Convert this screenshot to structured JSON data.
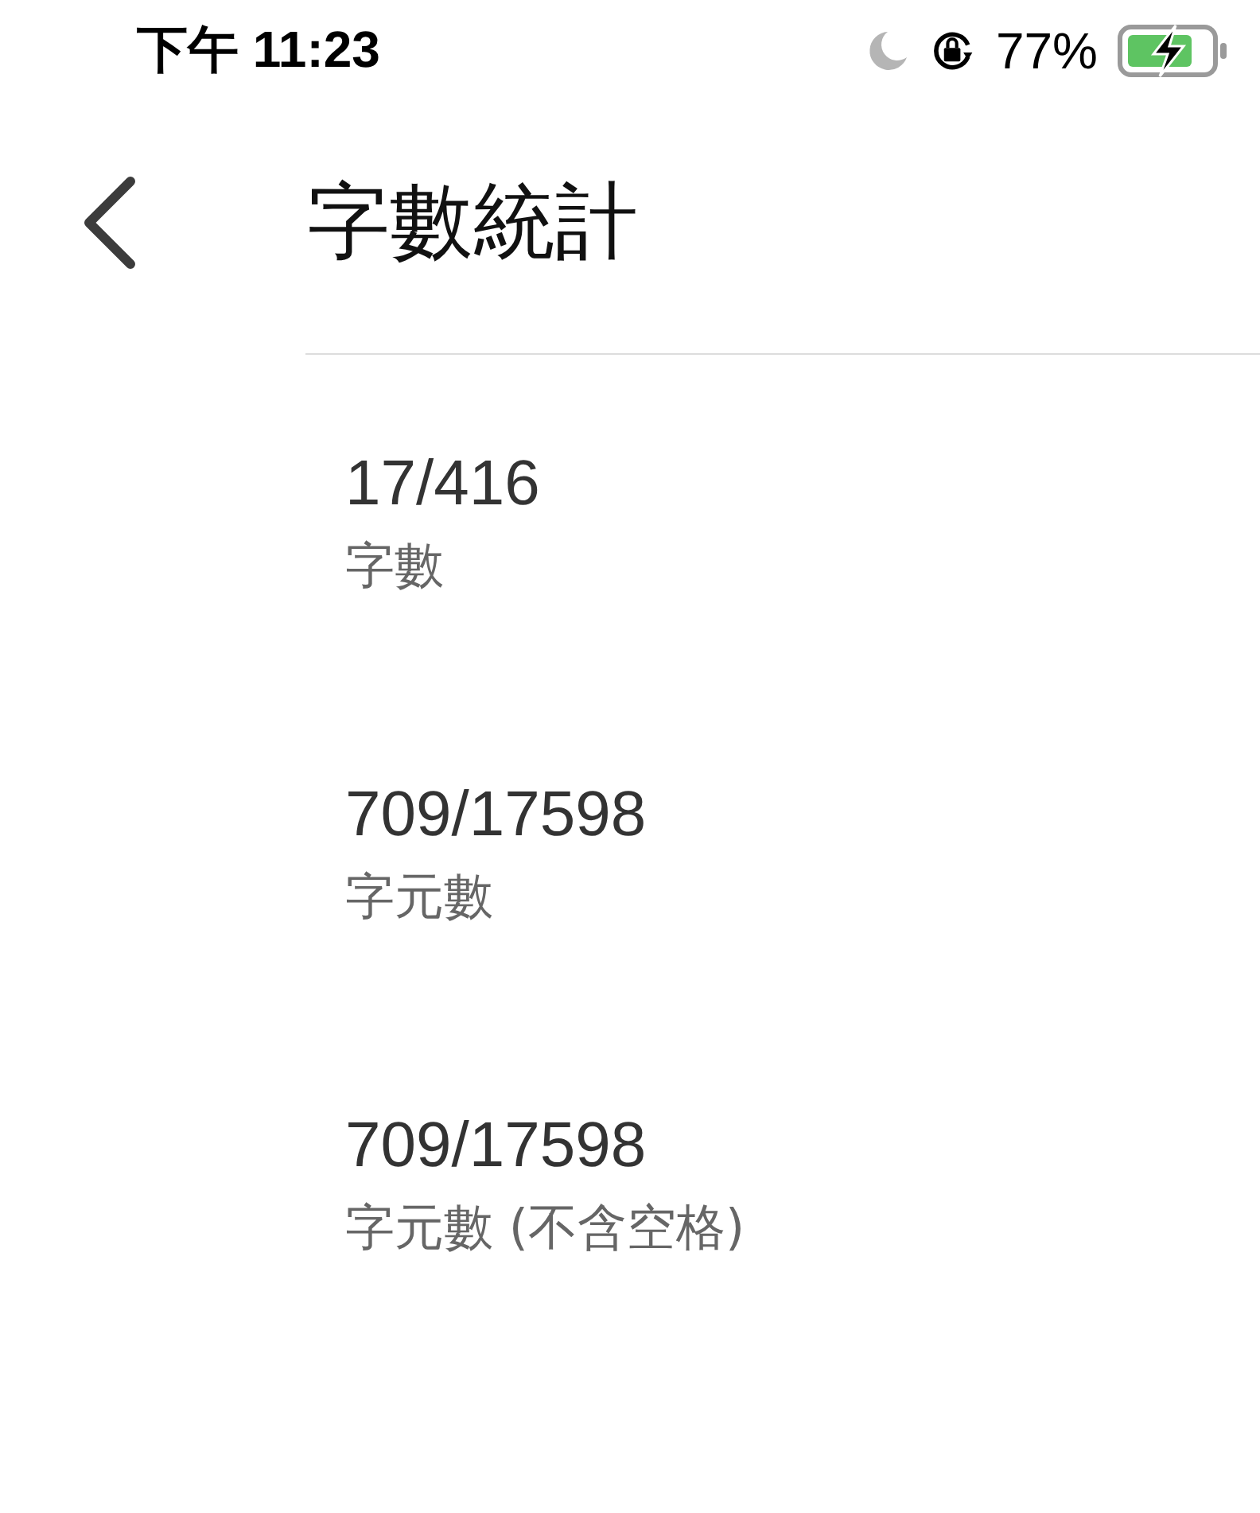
{
  "status_bar": {
    "time": "下午 11:23",
    "battery": "77%"
  },
  "header": {
    "title": "字數統計"
  },
  "stats": [
    {
      "value": "17/416",
      "label": "字數"
    },
    {
      "value": "709/17598",
      "label": "字元數"
    },
    {
      "value": "709/17598",
      "label": "字元數 (不含空格)"
    }
  ]
}
